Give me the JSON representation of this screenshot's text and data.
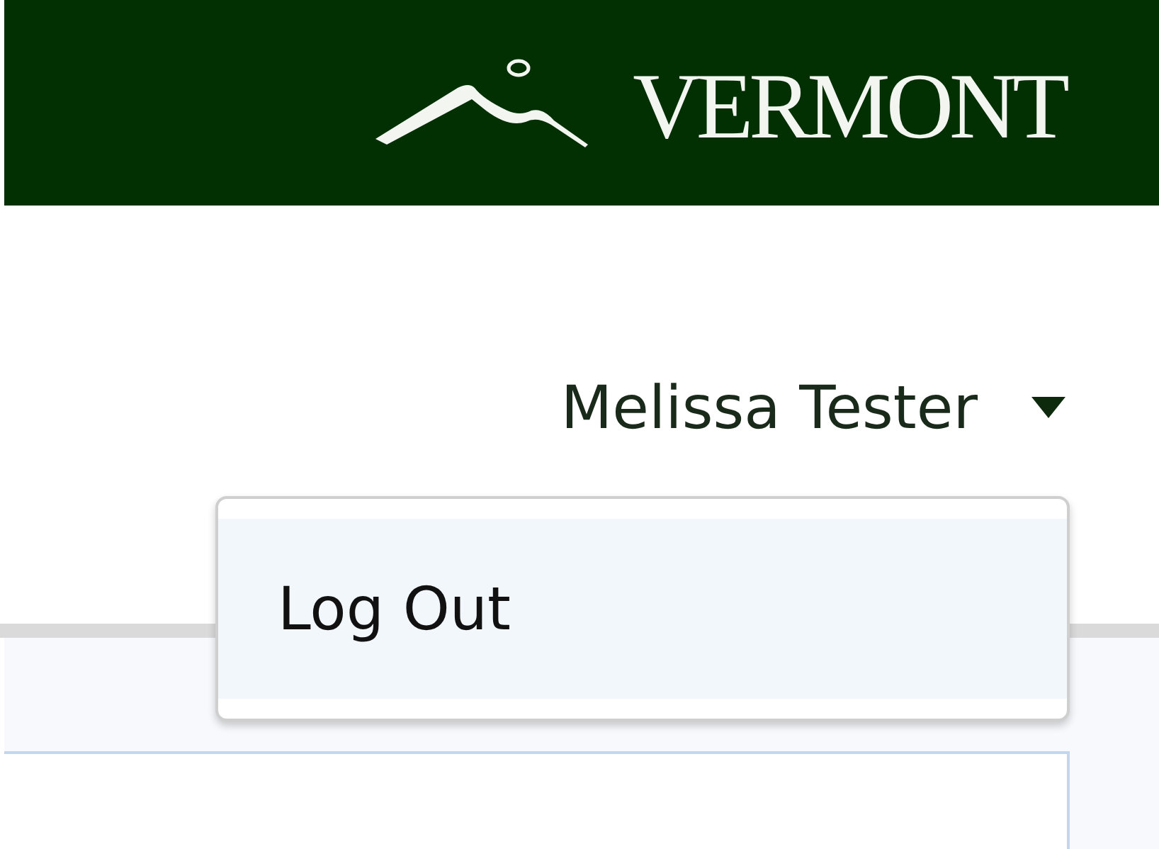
{
  "header": {
    "logo_text": "VERMONT"
  },
  "user_menu": {
    "name": "Melissa Tester",
    "expanded": true,
    "items": [
      {
        "label": "Log Out",
        "highlighted": true
      }
    ]
  }
}
